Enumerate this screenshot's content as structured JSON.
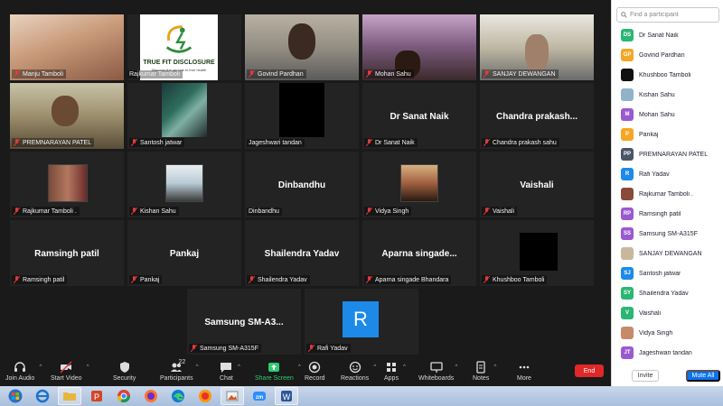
{
  "gallery": {
    "row1": [
      {
        "name": "Manju Tamboli",
        "display": "",
        "speaking": true,
        "kind": "video"
      },
      {
        "name": "Rajkumar Tamboli",
        "display": "",
        "kind": "logo"
      },
      {
        "name": "Govind Pardhan",
        "display": "",
        "kind": "video"
      },
      {
        "name": "Mohan Sahu",
        "display": "",
        "kind": "video"
      },
      {
        "name": "SANJAY DEWANGAN",
        "display": "",
        "kind": "video"
      }
    ],
    "row2": [
      {
        "name": "PREMNARAYAN PATEL",
        "display": "",
        "kind": "video"
      },
      {
        "name": "Santosh jatwar",
        "display": "",
        "kind": "video"
      },
      {
        "name": "Jageshwari tandan",
        "display": "",
        "kind": "video"
      },
      {
        "name": "Dr Sanat Naik",
        "display": "Dr Sanat Naik",
        "kind": "name"
      },
      {
        "name": "Chandra prakash sahu",
        "display": "Chandra prakash...",
        "kind": "name"
      }
    ],
    "row3": [
      {
        "name": "Rajkumar Tamboli .",
        "display": "",
        "kind": "photo"
      },
      {
        "name": "Kishan Sahu",
        "display": "",
        "kind": "photo"
      },
      {
        "name": "Dinbandhu",
        "display": "Dinbandhu",
        "kind": "name"
      },
      {
        "name": "Vidya Singh",
        "display": "",
        "kind": "photo"
      },
      {
        "name": "Vaishali",
        "display": "Vaishali",
        "kind": "name"
      }
    ],
    "row4": [
      {
        "name": "Ramsingh patil",
        "display": "Ramsingh patil",
        "kind": "name"
      },
      {
        "name": "Pankaj",
        "display": "Pankaj",
        "kind": "name"
      },
      {
        "name": "Shailendra Yadav",
        "display": "Shailendra Yadav",
        "kind": "name"
      },
      {
        "name": "Aparna singade Bhandara",
        "display": "Aparna singade...",
        "kind": "name"
      },
      {
        "name": "Khushboo Tamboli",
        "display": "",
        "kind": "black"
      }
    ],
    "row5": [
      {
        "name": "Samsung SM-A315F",
        "display": "Samsung SM-A3...",
        "kind": "name"
      },
      {
        "name": "Rafi Yadav",
        "display": "",
        "kind": "avatar",
        "initial": "R"
      }
    ],
    "logo": {
      "title": "TRUE FIT DISCLOSURE",
      "subtitle": "Discover the secrets to true health"
    }
  },
  "toolbar": {
    "join_audio": "Join Audio",
    "start_video": "Start Video",
    "security": "Security",
    "participants": "Participants",
    "participants_count": "22",
    "chat": "Chat",
    "share_screen": "Share Screen",
    "record": "Record",
    "reactions": "Reactions",
    "apps": "Apps",
    "whiteboards": "Whiteboards",
    "notes": "Notes",
    "more": "More",
    "end": "End"
  },
  "panel": {
    "search_placeholder": "Find a participant",
    "participants": [
      {
        "initials": "DS",
        "name": "Dr Sanat Naik",
        "color": "#2bb673"
      },
      {
        "initials": "GP",
        "name": "Govind Pardhan",
        "color": "#f5a623"
      },
      {
        "initials": "",
        "name": "Khushboo Tamboli",
        "color": "#111111"
      },
      {
        "initials": "",
        "name": "Kishan Sahu",
        "color": "#8fb3c9"
      },
      {
        "initials": "M",
        "name": "Mohan Sahu",
        "color": "#9b59d0"
      },
      {
        "initials": "P",
        "name": "Pankaj",
        "color": "#f5a623"
      },
      {
        "initials": "PP",
        "name": "PREMNARAYAN PATEL",
        "color": "#4a5568"
      },
      {
        "initials": "R",
        "name": "Rafi Yadav",
        "color": "#1d8ae8"
      },
      {
        "initials": "",
        "name": "Rajkumar Tamboli .",
        "color": "#8a4a3a"
      },
      {
        "initials": "RP",
        "name": "Ramsingh patil",
        "color": "#9b59d0"
      },
      {
        "initials": "SS",
        "name": "Samsung SM-A315F",
        "color": "#9b59d0"
      },
      {
        "initials": "",
        "name": "SANJAY DEWANGAN",
        "color": "#c9b79c"
      },
      {
        "initials": "SJ",
        "name": "Santosh jatwar",
        "color": "#1d8ae8"
      },
      {
        "initials": "SY",
        "name": "Shailendra Yadav",
        "color": "#2bb673"
      },
      {
        "initials": "V",
        "name": "Vaishali",
        "color": "#2bb673"
      },
      {
        "initials": "",
        "name": "Vidya Singh",
        "color": "#c68a6a"
      },
      {
        "initials": "JT",
        "name": "Jageshwari tandan",
        "color": "#9b59d0"
      }
    ],
    "invite": "Invite",
    "mute_all": "Mute All"
  },
  "taskbar": {
    "apps": [
      "start-orb",
      "internet-explorer",
      "file-explorer",
      "powerpoint",
      "chrome",
      "firefox",
      "edge",
      "firefox-alt",
      "photos",
      "zoom",
      "word"
    ]
  }
}
